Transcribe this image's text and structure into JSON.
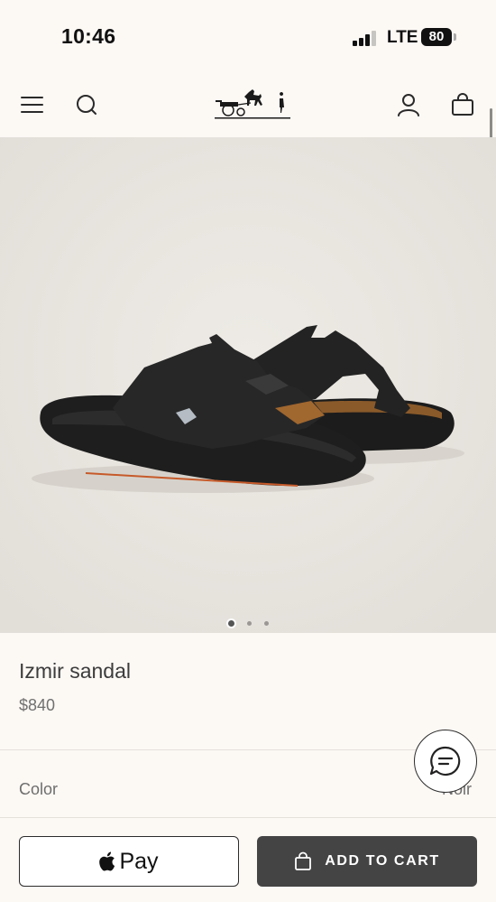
{
  "status_bar": {
    "time": "10:46",
    "network": "LTE",
    "battery": "80"
  },
  "header": {
    "menu_icon": "hamburger-menu-icon",
    "search_icon": "search-icon",
    "logo_icon": "horse-carriage-logo",
    "account_icon": "user-icon",
    "bag_icon": "shopping-bag-icon"
  },
  "gallery": {
    "image_count": 3,
    "active_index": 0
  },
  "product": {
    "name": "Izmir sandal",
    "price": "$840",
    "color_label": "Color",
    "color_value": "Noir"
  },
  "actions": {
    "apple_pay_label": "Pay",
    "add_to_cart_label": "ADD TO CART"
  },
  "colors": {
    "background": "#fcf8f4",
    "hero_background": "#e9e6e0",
    "cart_button": "#444444"
  }
}
